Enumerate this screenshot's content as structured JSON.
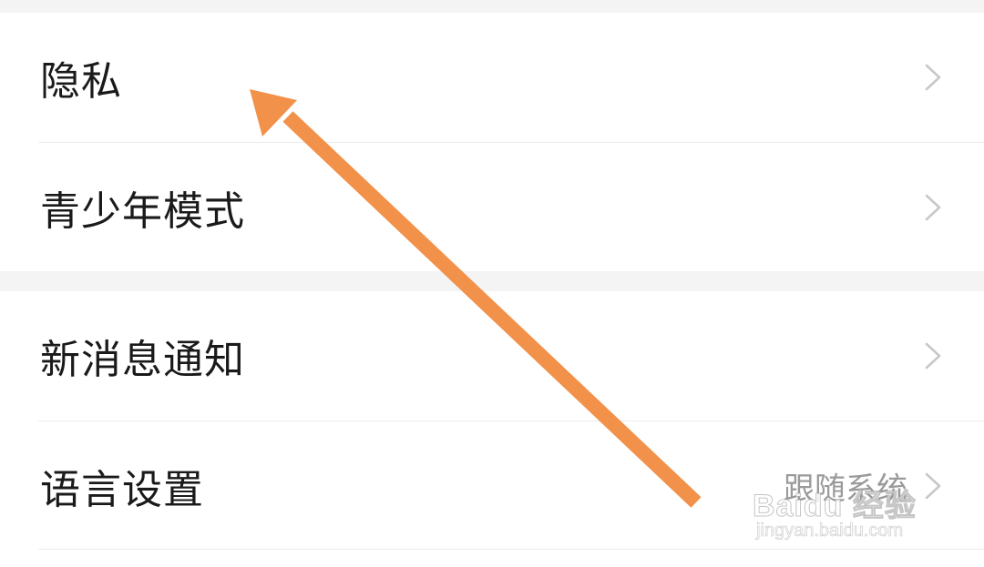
{
  "settings": {
    "group1": [
      {
        "label": "隐私"
      },
      {
        "label": "青少年模式"
      }
    ],
    "group2": [
      {
        "label": "新消息通知"
      },
      {
        "label": "语言设置",
        "value": "跟随系统"
      }
    ]
  },
  "icons": {
    "chevron": "chevron-right-icon"
  },
  "annotation": {
    "arrow_color": "#f2914a"
  },
  "watermark": {
    "brand": "Baidu 经验",
    "url": "jingyan.baidu.com"
  },
  "colors": {
    "page_bg": "#f4f4f4",
    "row_bg": "#ffffff",
    "divider": "#ececec",
    "label_text": "#1a1a1a",
    "value_text": "#9a9a9a",
    "chevron": "#c8c8c8"
  }
}
